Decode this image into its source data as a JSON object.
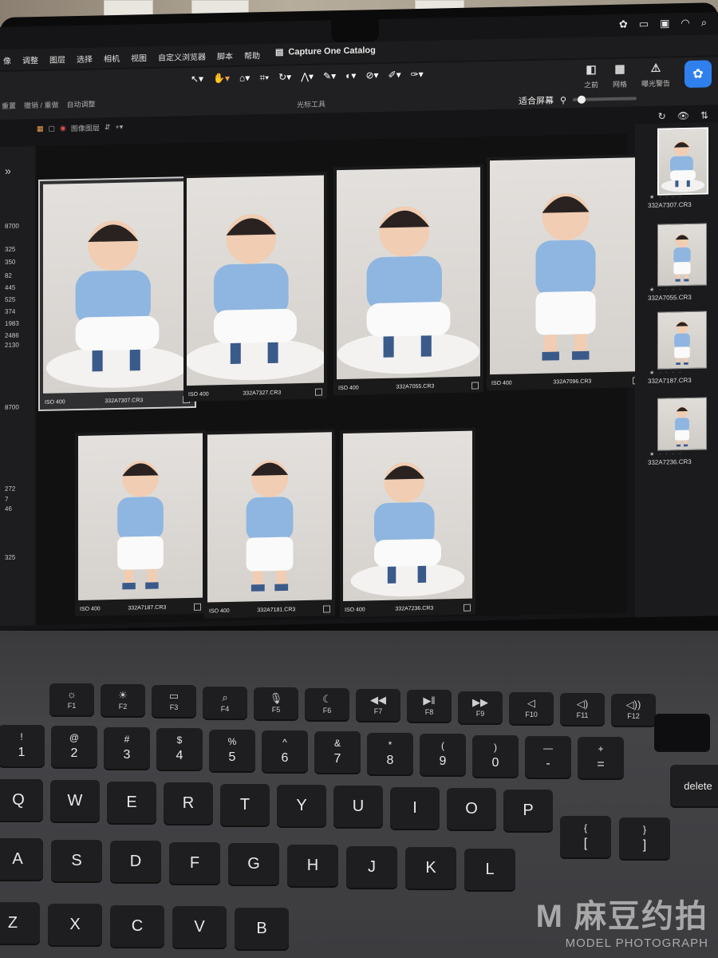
{
  "window": {
    "title": "Capture One Catalog"
  },
  "menu": [
    "像",
    "调整",
    "图层",
    "选择",
    "相机",
    "视图",
    "自定义浏览器",
    "脚本",
    "帮助"
  ],
  "toolbar": {
    "cursor_tools_label": "光标工具",
    "left_labels": [
      "重置",
      "撤销 / 重做",
      "自动调整"
    ],
    "right_items": [
      {
        "icon": "before-icon",
        "label": "之前"
      },
      {
        "icon": "grid-icon",
        "label": "网格"
      },
      {
        "icon": "exposure-warning-icon",
        "label": "曝光警告"
      }
    ],
    "fit_label": "适合屏幕",
    "view_label": "图像图层"
  },
  "left_panel_numbers": [
    "8700",
    "325",
    "350",
    "82",
    "445",
    "525",
    "374",
    "1983",
    "2486",
    "2130",
    "8700",
    "272",
    "7",
    "46",
    "325"
  ],
  "grid": [
    {
      "iso": "ISO 400",
      "filename": "332A7307.CR3",
      "selected": true
    },
    {
      "iso": "ISO 400",
      "filename": "332A7327.CR3",
      "selected": false
    },
    {
      "iso": "ISO 400",
      "filename": "332A7055.CR3",
      "selected": false
    },
    {
      "iso": "ISO 400",
      "filename": "332A7096.CR3",
      "selected": false
    },
    {
      "iso": "ISO 400",
      "filename": "332A7187.CR3",
      "selected": false
    },
    {
      "iso": "ISO 400",
      "filename": "332A7181.CR3",
      "selected": false
    },
    {
      "iso": "ISO 400",
      "filename": "332A7236.CR3",
      "selected": false
    }
  ],
  "filmstrip": [
    "332A7307.CR3",
    "332A7055.CR3",
    "332A7187.CR3",
    "332A7236.CR3"
  ],
  "keyboard": {
    "fn_row": [
      {
        "glyph": "☼",
        "label": "F1"
      },
      {
        "glyph": "☀",
        "label": "F2"
      },
      {
        "glyph": "▭",
        "label": "F3"
      },
      {
        "glyph": "⌕",
        "label": "F4"
      },
      {
        "glyph": "🎙",
        "label": "F5"
      },
      {
        "glyph": "☾",
        "label": "F6"
      },
      {
        "glyph": "◀◀",
        "label": "F7"
      },
      {
        "glyph": "▶‖",
        "label": "F8"
      },
      {
        "glyph": "▶▶",
        "label": "F9"
      },
      {
        "glyph": "◁",
        "label": "F10"
      },
      {
        "glyph": "◁)",
        "label": "F11"
      },
      {
        "glyph": "◁))",
        "label": "F12"
      }
    ],
    "number_row": [
      {
        "top": "!",
        "bottom": "1"
      },
      {
        "top": "@",
        "bottom": "2"
      },
      {
        "top": "#",
        "bottom": "3"
      },
      {
        "top": "$",
        "bottom": "4"
      },
      {
        "top": "%",
        "bottom": "5"
      },
      {
        "top": "^",
        "bottom": "6"
      },
      {
        "top": "&",
        "bottom": "7"
      },
      {
        "top": "*",
        "bottom": "8"
      },
      {
        "top": "(",
        "bottom": "9"
      },
      {
        "top": ")",
        "bottom": "0"
      },
      {
        "top": "—",
        "bottom": "-"
      },
      {
        "top": "+",
        "bottom": "="
      }
    ],
    "qwerty_row": [
      "Q",
      "W",
      "E",
      "R",
      "T",
      "Y",
      "U",
      "I",
      "O",
      "P"
    ],
    "bracket_keys": [
      {
        "top": "{",
        "bottom": "["
      },
      {
        "top": "}",
        "bottom": "]"
      }
    ],
    "home_row": [
      "A",
      "S",
      "D",
      "F",
      "G",
      "H",
      "J",
      "K",
      "L"
    ],
    "bottom_row": [
      "Z",
      "X",
      "C",
      "V",
      "B"
    ],
    "delete_label": "delete"
  },
  "watermark": {
    "line1": "M 麻豆约拍",
    "line2": "MODEL PHOTOGRAPH"
  }
}
